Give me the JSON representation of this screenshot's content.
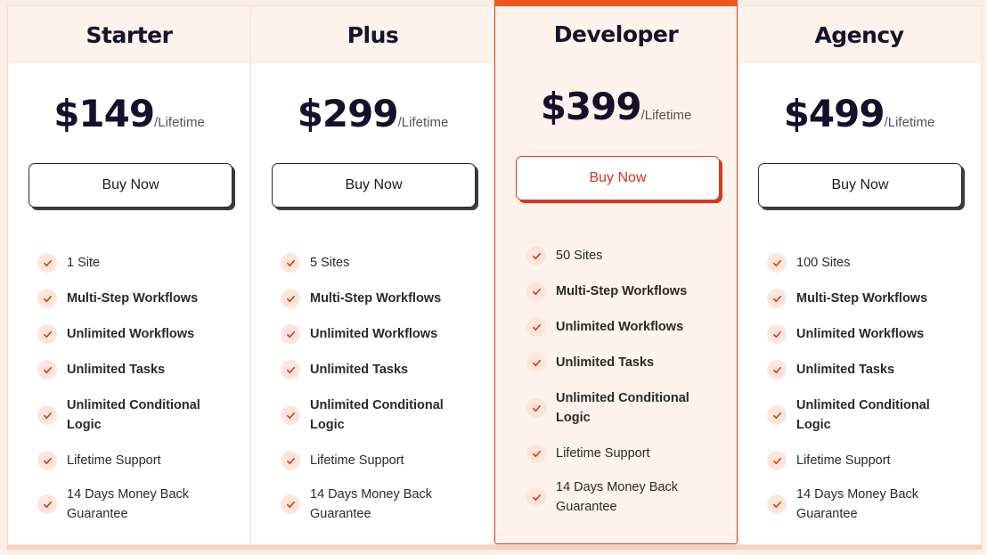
{
  "plans": [
    {
      "name": "Starter",
      "price": "$149",
      "period": "/Lifetime",
      "button": "Buy Now",
      "features": [
        "1 Site",
        "Multi-Step Workflows",
        "Unlimited Workflows",
        "Unlimited Tasks",
        "Unlimited Conditional Logic",
        "Lifetime Support",
        "14 Days Money Back Guarantee"
      ]
    },
    {
      "name": "Plus",
      "price": "$299",
      "period": "/Lifetime",
      "button": "Buy Now",
      "features": [
        "5 Sites",
        "Multi-Step Workflows",
        "Unlimited Workflows",
        "Unlimited Tasks",
        "Unlimited Conditional Logic",
        "Lifetime Support",
        "14 Days Money Back Guarantee"
      ]
    },
    {
      "name": "Developer",
      "price": "$399",
      "period": "/Lifetime",
      "button": "Buy Now",
      "featured": true,
      "features": [
        "50 Sites",
        "Multi-Step Workflows",
        "Unlimited Workflows",
        "Unlimited Tasks",
        "Unlimited Conditional Logic",
        "Lifetime Support",
        "14 Days Money Back Guarantee"
      ]
    },
    {
      "name": "Agency",
      "price": "$499",
      "period": "/Lifetime",
      "button": "Buy Now",
      "features": [
        "100 Sites",
        "Multi-Step Workflows",
        "Unlimited Workflows",
        "Unlimited Tasks",
        "Unlimited Conditional Logic",
        "Lifetime Support",
        "14 Days Money Back Guarantee"
      ]
    }
  ],
  "colors": {
    "accent": "#f2561e",
    "accent_text": "#d2361a",
    "check": "#d8391a",
    "header_bg": "#fdf2ec"
  },
  "icons": {
    "feature_check": "check-icon"
  }
}
